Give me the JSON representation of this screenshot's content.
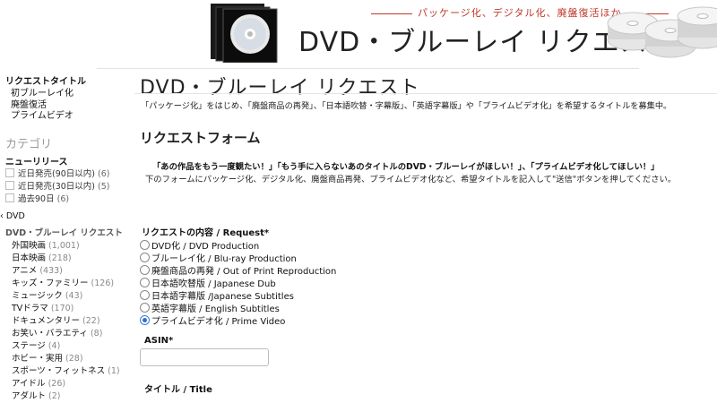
{
  "banner": {
    "tagline": "パッケージ化、デジタル化、廃盤復活ほか",
    "title": "DVD・ブルーレイ リクエスト"
  },
  "sidebar": {
    "title": "リクエストタイトル",
    "subs": [
      "初ブルーレイ化",
      "廃盤復活",
      "プライムビデオ"
    ],
    "category_heading": "カテゴリ",
    "new_release_heading": "ニューリリース",
    "checks": [
      {
        "label": "近日発売(90日以内)",
        "count": "(6)"
      },
      {
        "label": "近日発売(30日以内)",
        "count": "(5)"
      },
      {
        "label": "過去90日",
        "count": "(6)"
      }
    ],
    "dvd_link": "‹ DVD",
    "dvd_request": "DVD・ブルーレイ リクエスト",
    "genres": [
      {
        "label": "外国映画",
        "count": "(1,001)"
      },
      {
        "label": "日本映画",
        "count": "(218)"
      },
      {
        "label": "アニメ",
        "count": "(433)"
      },
      {
        "label": "キッズ・ファミリー",
        "count": "(126)"
      },
      {
        "label": "ミュージック",
        "count": "(43)"
      },
      {
        "label": "TVドラマ",
        "count": "(170)"
      },
      {
        "label": "ドキュメンタリー",
        "count": "(22)"
      },
      {
        "label": "お笑い・バラエティ",
        "count": "(8)"
      },
      {
        "label": "ステージ",
        "count": "(4)"
      },
      {
        "label": "ホビー・実用",
        "count": "(28)"
      },
      {
        "label": "スポーツ・フィットネス",
        "count": "(1)"
      },
      {
        "label": "アイドル",
        "count": "(26)"
      },
      {
        "label": "アダルト",
        "count": "(2)"
      }
    ]
  },
  "main": {
    "title": "DVD・ブルーレイ リクエスト",
    "description": "「パッケージ化」をはじめ、「廃盤商品の再発」、「日本語吹替・字幕版」、「英語字幕版」や「プライムビデオ化」を希望するタイトルを募集中。",
    "form_title": "リクエストフォーム",
    "intro_bold": "「あの作品をもう一度観たい！」「もう手に入らないあのタイトルのDVD・ブルーレイがほしい！」、「プライムビデオ化してほしい！」",
    "intro_text": "下のフォームにパッケージ化、デジタル化、廃盤商品再発、プライムビデオ化など、希望タイトルを記入して\"送信\"ボタンを押してください。",
    "request_label": "リクエストの内容 / Request*",
    "options": [
      {
        "label": "DVD化 / DVD Production",
        "selected": false
      },
      {
        "label": "ブルーレイ化 / Blu-ray Production",
        "selected": false
      },
      {
        "label": "廃盤商品の再発 / Out of Print Reproduction",
        "selected": false
      },
      {
        "label": "日本語吹替版 / Japanese Dub",
        "selected": false
      },
      {
        "label": "日本語字幕版 /Japanese Subtitles",
        "selected": false
      },
      {
        "label": "英語字幕版 / English Subtitles",
        "selected": false
      },
      {
        "label": "プライムビデオ化 / Prime Video",
        "selected": true
      }
    ],
    "asin_label": "ASIN*",
    "asin_value": "",
    "title_label": "タイトル / Title"
  }
}
